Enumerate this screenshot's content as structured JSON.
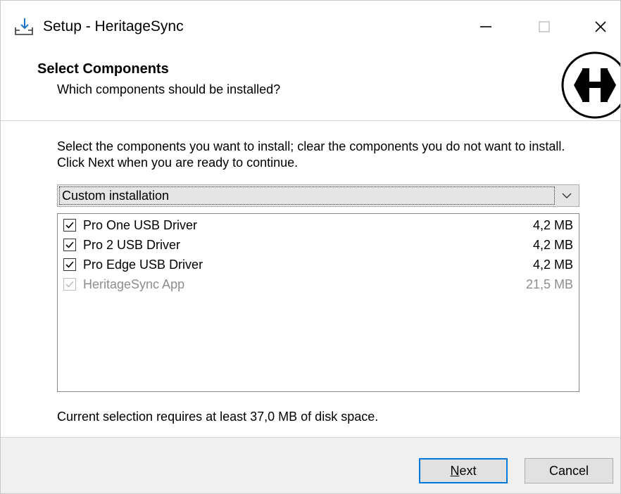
{
  "window": {
    "title": "Setup - HeritageSync",
    "controls": {
      "minimize": "—",
      "maximize": "☐",
      "close": "✕"
    }
  },
  "header": {
    "title": "Select Components",
    "subtitle": "Which components should be installed?",
    "logo_letter": "H"
  },
  "body": {
    "instructions": "Select the components you want to install; clear the components you do not want to install. Click Next when you are ready to continue.",
    "install_type": {
      "selected": "Custom installation"
    },
    "components": [
      {
        "label": "Pro One USB Driver",
        "size": "4,2 MB",
        "checked": true,
        "enabled": true
      },
      {
        "label": "Pro 2 USB Driver",
        "size": "4,2 MB",
        "checked": true,
        "enabled": true
      },
      {
        "label": "Pro Edge USB Driver",
        "size": "4,2 MB",
        "checked": true,
        "enabled": true
      },
      {
        "label": "HeritageSync App",
        "size": "21,5 MB",
        "checked": true,
        "enabled": false
      }
    ],
    "disk_space": "Current selection requires at least 37,0 MB of disk space."
  },
  "footer": {
    "next_prefix": "",
    "next_accel": "N",
    "next_rest": "ext",
    "cancel_label": "Cancel"
  },
  "colors": {
    "accent": "#0078d7",
    "footer_bg": "#f0f0f0",
    "disabled_text": "#8d8d8d"
  },
  "icons": {
    "app": "download-tray-icon",
    "dropdown": "chevron-down-icon",
    "checkbox": "checkmark-icon"
  }
}
